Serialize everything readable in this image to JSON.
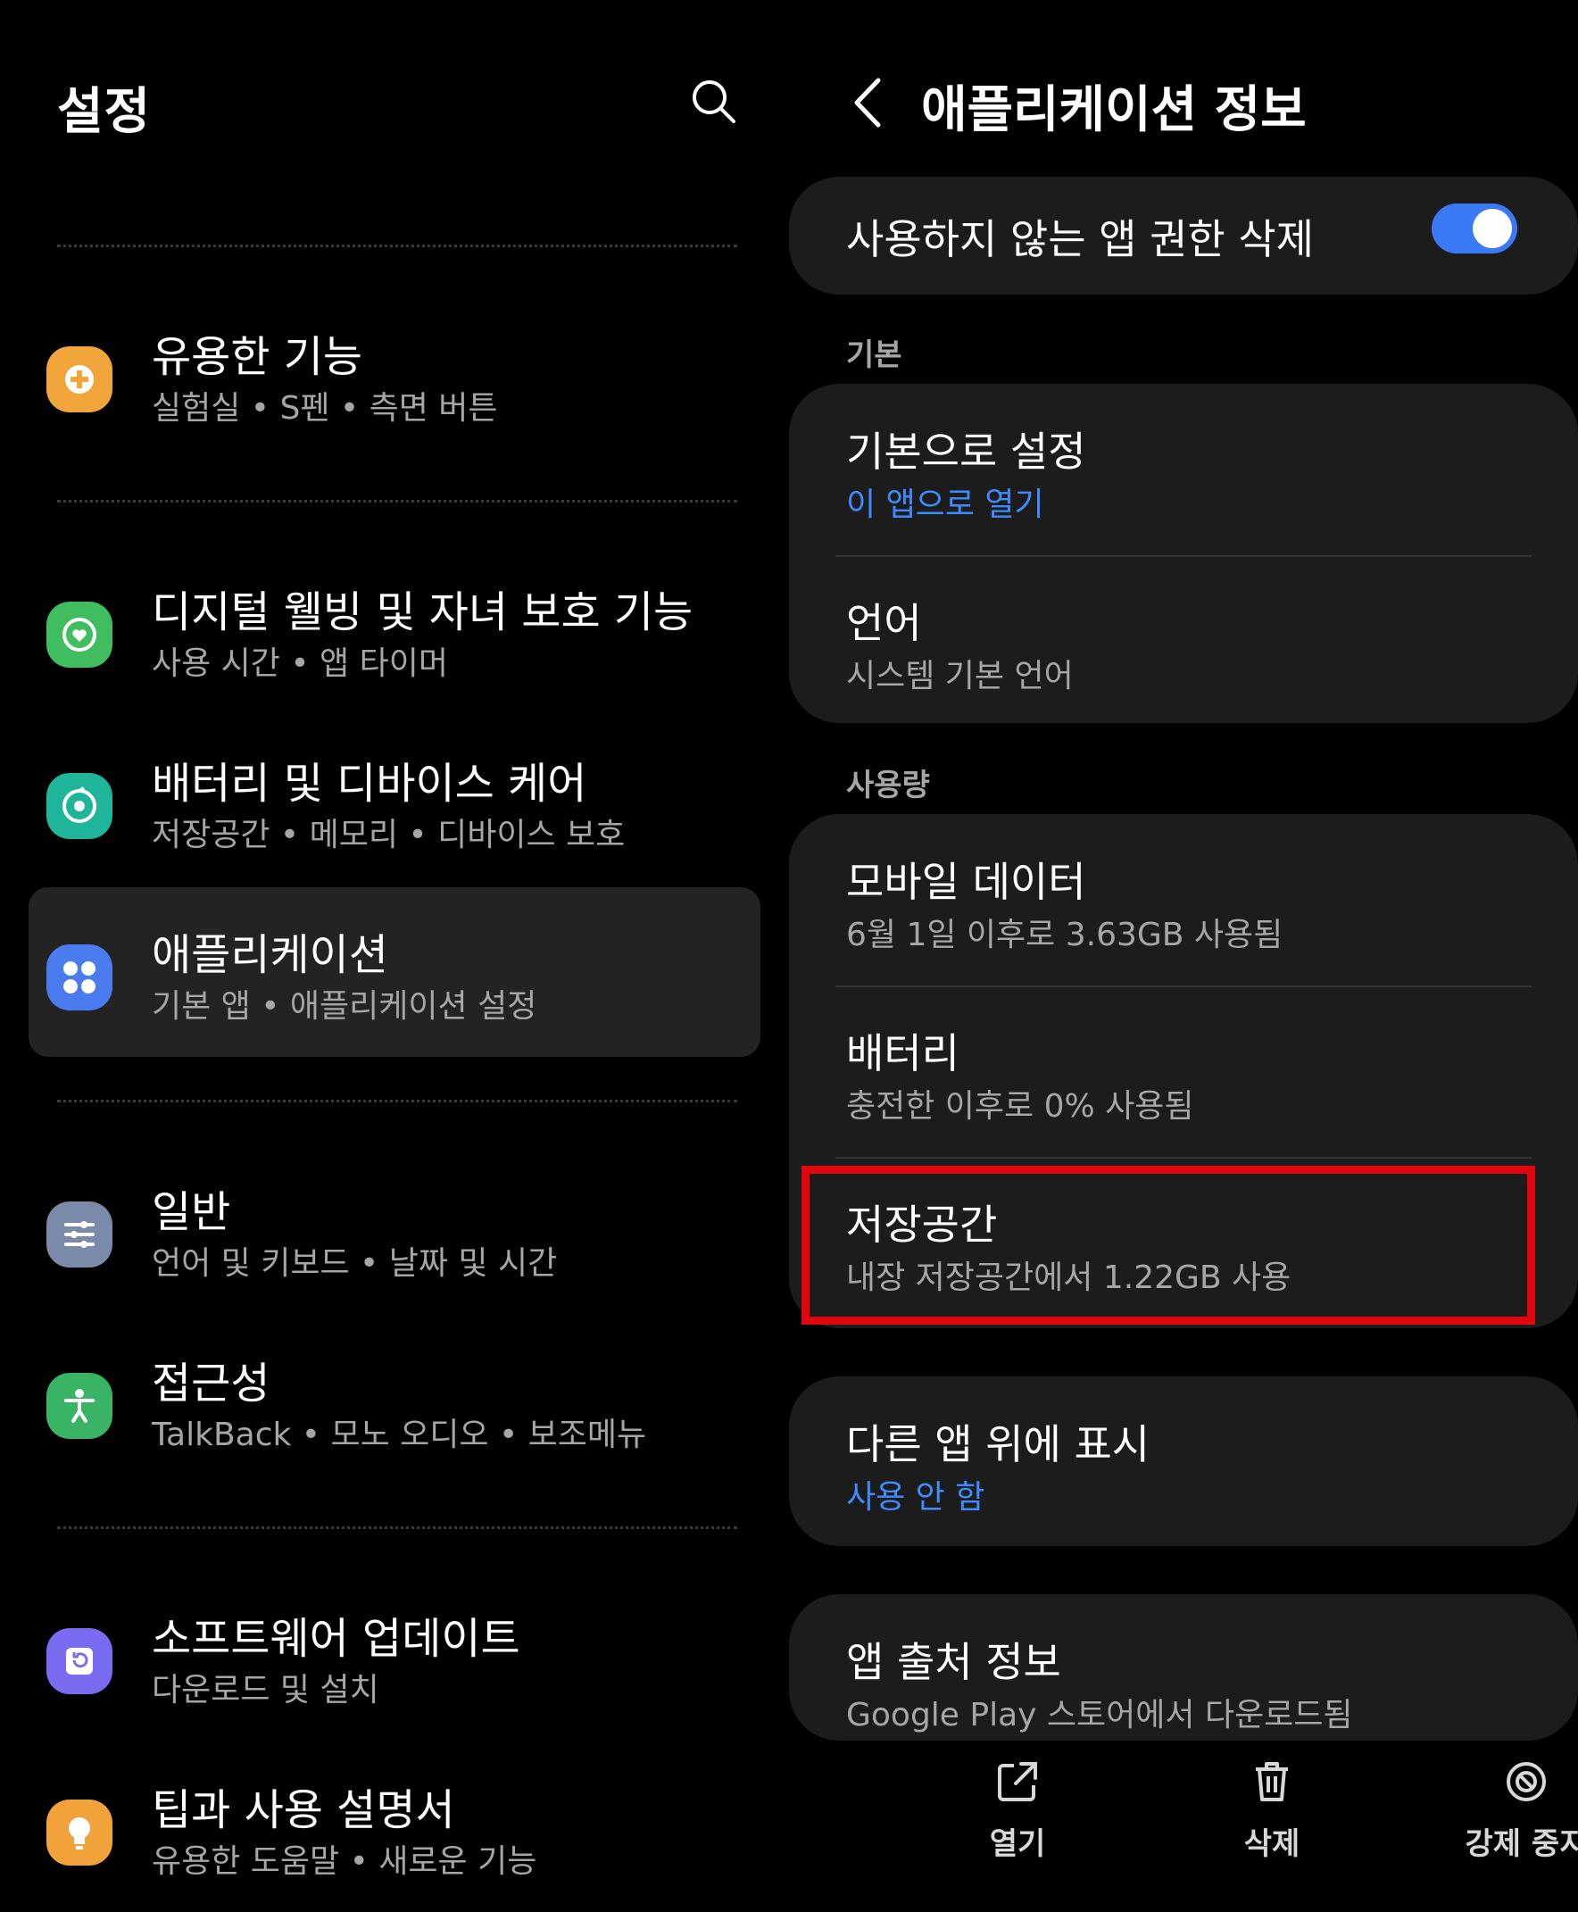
{
  "left": {
    "title": "설정",
    "items": [
      {
        "title": "유용한 기능",
        "subtitle": "실험실  •  S펜  •  측면 버튼",
        "icon": "puzzle-plus-icon",
        "color": "#f0a63a"
      },
      {
        "title": "디지털 웰빙 및 자녀 보호 기능",
        "subtitle": "사용 시간  •  앱 타이머",
        "icon": "wellbeing-icon",
        "color": "#3fbd5f"
      },
      {
        "title": "배터리 및 디바이스 케어",
        "subtitle": "저장공간  •  메모리  •  디바이스 보호",
        "icon": "device-care-icon",
        "color": "#1fb59a"
      },
      {
        "title": "애플리케이션",
        "subtitle": "기본 앱  •  애플리케이션 설정",
        "icon": "apps-icon",
        "color": "#4a7cf0"
      },
      {
        "title": "일반",
        "subtitle": "언어 및 키보드  •  날짜 및 시간",
        "icon": "sliders-icon",
        "color": "#7a8aa8"
      },
      {
        "title": "접근성",
        "subtitle": "TalkBack  •  모노 오디오  •  보조메뉴",
        "icon": "accessibility-icon",
        "color": "#39b364"
      },
      {
        "title": "소프트웨어 업데이트",
        "subtitle": "다운로드 및 설치",
        "icon": "update-icon",
        "color": "#7a6cf0"
      },
      {
        "title": "팁과 사용 설명서",
        "subtitle": "유용한 도움말  •  새로운 기능",
        "icon": "bulb-icon",
        "color": "#f2a23a"
      }
    ]
  },
  "right": {
    "title": "애플리케이션 정보",
    "toggle_label": "사용하지 않는 앱 권한 삭제",
    "toggle_on": true,
    "section_basic": "기본",
    "default_title": "기본으로 설정",
    "default_sub": "이 앱으로 열기",
    "lang_title": "언어",
    "lang_sub": "시스템 기본 언어",
    "section_usage": "사용량",
    "mobile_title": "모바일 데이터",
    "mobile_sub": "6월 1일 이후로 3.63GB 사용됨",
    "battery_title": "배터리",
    "battery_sub": "충전한 이후로 0% 사용됨",
    "storage_title": "저장공간",
    "storage_sub": "내장 저장공간에서 1.22GB 사용",
    "overlay_title": "다른 앱 위에 표시",
    "overlay_sub": "사용 안 함",
    "source_title": "앱 출처 정보",
    "source_sub": "Google Play 스토어에서 다운로드됨",
    "open": "열기",
    "delete": "삭제",
    "force_stop": "강제 중지"
  }
}
